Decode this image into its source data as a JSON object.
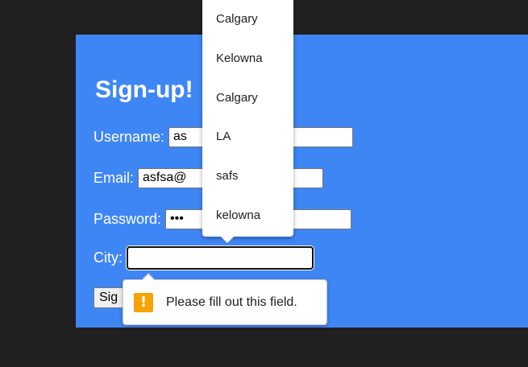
{
  "form": {
    "title": "Sign-up!",
    "username_label": "Username:",
    "username_value": "as",
    "email_label": "Email:",
    "email_value": "asfsa@",
    "password_label": "Password:",
    "password_value": "•••",
    "city_label": "City:",
    "city_value": "",
    "submit_label": "Sig"
  },
  "suggestions": {
    "items": [
      "Calgary",
      "Kelowna",
      "Calgary",
      "LA",
      "safs",
      "kelowna"
    ]
  },
  "validation": {
    "message": "Please fill out this field.",
    "icon": "warning-icon",
    "icon_glyph": "!"
  },
  "colors": {
    "page_background": "#202020",
    "form_background": "#3f86f5",
    "warning": "#f5a300"
  }
}
